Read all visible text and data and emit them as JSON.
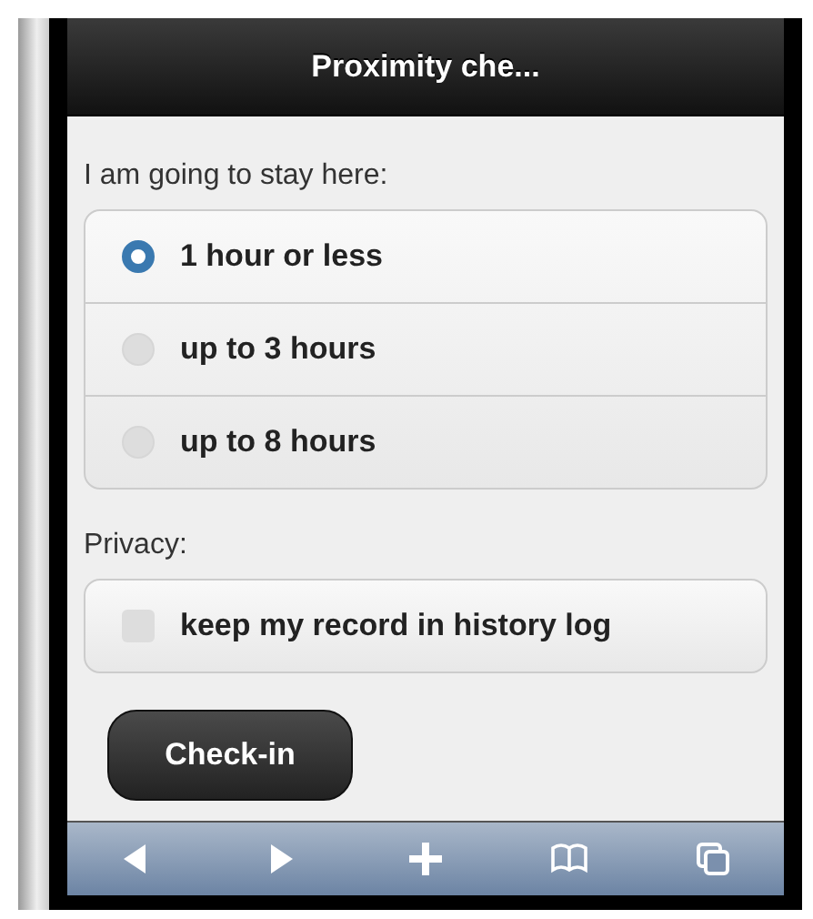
{
  "header": {
    "title": "Proximity che..."
  },
  "stay": {
    "label": "I am going to stay here:",
    "options": [
      {
        "label": "1 hour or less",
        "selected": true
      },
      {
        "label": "up to 3 hours",
        "selected": false
      },
      {
        "label": "up to 8 hours",
        "selected": false
      }
    ]
  },
  "privacy": {
    "label": "Privacy:",
    "options": [
      {
        "label": "keep my record in history log",
        "checked": false
      }
    ]
  },
  "button": "Check-in",
  "toolbar": [
    {
      "kind": "back"
    },
    {
      "kind": "forward"
    },
    {
      "kind": "add"
    },
    {
      "kind": "bookmarks"
    },
    {
      "kind": "pages"
    }
  ]
}
